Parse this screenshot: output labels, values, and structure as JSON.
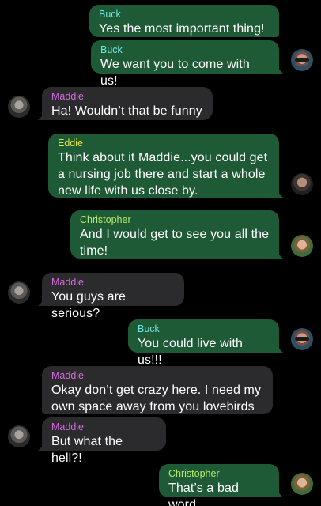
{
  "colors": {
    "background": "#000000",
    "outgoing_bubble": "#1f5a37",
    "incoming_bubble": "#2b2b2e",
    "buck": "#6fe7e0",
    "maddie": "#d86ae0",
    "eddie": "#e6e649",
    "christopher": "#b4e86a"
  },
  "messages": [
    {
      "sender": "Buck",
      "text": "Yes the most important thing!"
    },
    {
      "sender": "Buck",
      "text": "We want you to come with us!"
    },
    {
      "sender": "Maddie",
      "text": "Ha! Wouldn’t that be funny"
    },
    {
      "sender": "Eddie",
      "text": "Think about it Maddie...you could get\na nursing job there and start a whole\nnew life with us close by."
    },
    {
      "sender": "Christopher",
      "text": "And I would get to see you all the\ntime!"
    },
    {
      "sender": "Maddie",
      "text": "You guys are serious?"
    },
    {
      "sender": "Buck",
      "text": "You could live with us!!!"
    },
    {
      "sender": "Maddie",
      "text": "Okay don’t get crazy here. I need my\nown space away from you lovebirds"
    },
    {
      "sender": "Maddie",
      "text": "But what the hell?!"
    },
    {
      "sender": "Christopher",
      "text": "That’s a bad word"
    }
  ]
}
